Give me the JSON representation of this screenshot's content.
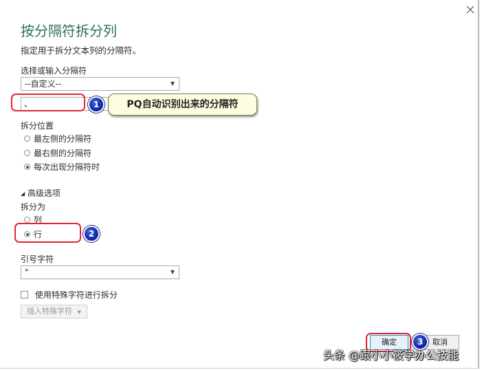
{
  "dialog": {
    "title": "按分隔符拆分列",
    "subtitle": "指定用于拆分文本列的分隔符。",
    "close_icon": "close-icon"
  },
  "delimiter": {
    "label": "选择或输入分隔符",
    "selected": "--自定义--",
    "custom_value": "、"
  },
  "split_position": {
    "label": "拆分位置",
    "options": [
      {
        "label": "最左侧的分隔符",
        "selected": false
      },
      {
        "label": "最右侧的分隔符",
        "selected": false
      },
      {
        "label": "每次出现分隔符时",
        "selected": true
      }
    ]
  },
  "advanced": {
    "toggle_label": "高级选项",
    "split_into_label": "拆分为",
    "split_into_options": [
      {
        "label": "列",
        "selected": false
      },
      {
        "label": "行",
        "selected": true
      }
    ],
    "quote_label": "引号字符",
    "quote_value": "\"",
    "special_chars_label": "使用特殊字符进行拆分",
    "special_chars_checked": false,
    "insert_special_label": "插入特殊字符"
  },
  "buttons": {
    "ok": "确定",
    "cancel": "取消"
  },
  "annotations": {
    "callout_text": "PQ自动识别出来的分隔符",
    "badges": [
      "1",
      "2",
      "3"
    ],
    "highlight_color": "#e3242b",
    "badge_color": "#1a35c0"
  },
  "watermark": "头条 @跟小小筱学办公技能"
}
